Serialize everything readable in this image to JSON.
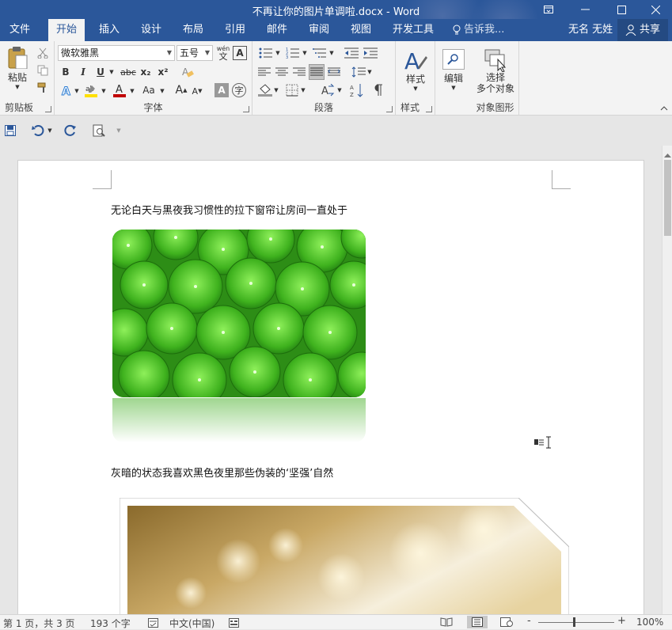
{
  "window": {
    "title": "不再让你的图片单调啦.docx - Word"
  },
  "tabs": [
    {
      "label": "文件"
    },
    {
      "label": "开始"
    },
    {
      "label": "插入"
    },
    {
      "label": "设计"
    },
    {
      "label": "布局"
    },
    {
      "label": "引用"
    },
    {
      "label": "邮件"
    },
    {
      "label": "审阅"
    },
    {
      "label": "视图"
    },
    {
      "label": "开发工具"
    }
  ],
  "tell_me": {
    "label": "告诉我..."
  },
  "user": {
    "name": "无名 无姓"
  },
  "share": {
    "label": "共享"
  },
  "ribbon": {
    "clipboard": {
      "paste_label": "粘贴",
      "group_label": "剪贴板"
    },
    "font": {
      "font_name": "微软雅黑",
      "font_size": "五号",
      "pinyin_top": "wén",
      "pinyin_bottom": "文",
      "bold": "B",
      "italic": "I",
      "underline": "U",
      "strike": "abc",
      "subscript": "x₂",
      "superscript": "x²",
      "grow": "A",
      "shrink": "A",
      "change_case": "Aa",
      "group_label": "字体"
    },
    "paragraph": {
      "group_label": "段落"
    },
    "styles": {
      "label": "样式",
      "group_label": "样式"
    },
    "editing": {
      "label": "编辑"
    },
    "select": {
      "label_line1": "选择",
      "label_line2": "多个对象",
      "group_label": "对象图形"
    }
  },
  "document": {
    "para1": "无论白天与黑夜我习惯性的拉下窗帘让房间一直处于",
    "para2": "灰暗的状态我喜欢黑色夜里那些伪装的‘坚强’自然"
  },
  "status": {
    "page": "第 1 页，共 3 页",
    "words": "193 个字",
    "language": "中文(中国)",
    "zoom": "100%",
    "zoom_minus": "-",
    "zoom_plus": "+"
  },
  "colors": {
    "accent": "#2b579a",
    "highlight": "#ffe000",
    "font_color": "#c00000"
  }
}
